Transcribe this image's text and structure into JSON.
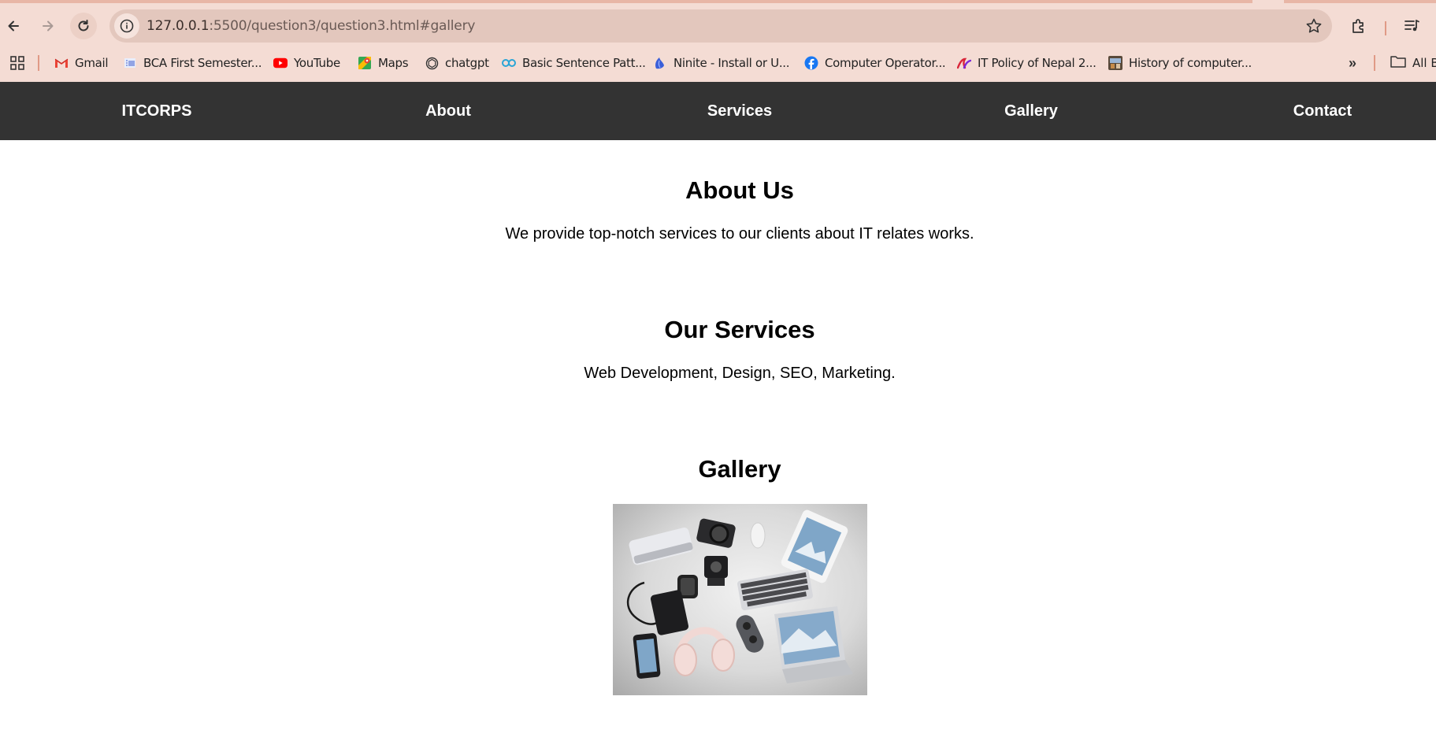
{
  "browser": {
    "url_host": "127.0.0.1",
    "url_path": ":5500/question3/question3.html#gallery",
    "bookmarks": [
      {
        "label": "Gmail",
        "icon": "gmail-icon"
      },
      {
        "label": "BCA First Semester...",
        "icon": "bca-icon"
      },
      {
        "label": "YouTube",
        "icon": "youtube-icon"
      },
      {
        "label": "Maps",
        "icon": "maps-icon"
      },
      {
        "label": "chatgpt",
        "icon": "chatgpt-icon"
      },
      {
        "label": "Basic Sentence Patt...",
        "icon": "quillbot-icon"
      },
      {
        "label": "Ninite - Install or U...",
        "icon": "ninite-icon"
      },
      {
        "label": "Computer Operator...",
        "icon": "facebook-icon"
      },
      {
        "label": "IT Policy of Nepal 2...",
        "icon": "policy-icon"
      },
      {
        "label": "History of computer...",
        "icon": "history-icon"
      }
    ],
    "all_bookmarks_label": "All B"
  },
  "site": {
    "brand": "ITCORPS",
    "nav": [
      "About",
      "Services",
      "Gallery",
      "Contact"
    ],
    "about": {
      "title": "About Us",
      "text": "We provide top-notch services to our clients about IT relates works."
    },
    "services": {
      "title": "Our Services",
      "text": "Web Development, Design, SEO, Marketing."
    },
    "gallery": {
      "title": "Gallery",
      "image": "electronic-gadgets-photo"
    }
  },
  "colors": {
    "chrome_bg": "#f4dcd4",
    "omnibox_bg": "#e3c7bd",
    "site_nav_bg": "#333333",
    "site_nav_text": "#ffffff"
  }
}
